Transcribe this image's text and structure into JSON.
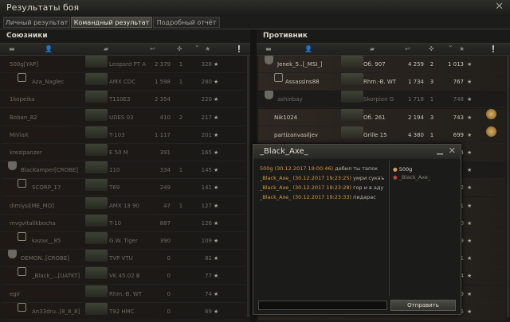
{
  "window": {
    "title": "Результаты боя"
  },
  "tabs": [
    {
      "label": "Личный результат",
      "active": false
    },
    {
      "label": "Командный результат",
      "active": true
    },
    {
      "label": "Подробный отчёт",
      "active": false
    }
  ],
  "allies": {
    "header": "Союзники",
    "rows": [
      {
        "name": "500g[YAP]",
        "tank": "Leopard PT A",
        "damage": "2 379",
        "kills": "1",
        "xp": "328",
        "alive": false,
        "platoon": false,
        "clan": false
      },
      {
        "name": "Aza_Naglec",
        "tank": "AMX CDC",
        "damage": "1 598",
        "kills": "1",
        "xp": "280",
        "alive": false,
        "platoon": true,
        "clan": false
      },
      {
        "name": "1kopeika",
        "tank": "T110E3",
        "damage": "2 354",
        "kills": "",
        "xp": "220",
        "alive": false,
        "platoon": false,
        "clan": false
      },
      {
        "name": "Boban_82",
        "tank": "UDES 03",
        "damage": "410",
        "kills": "2",
        "xp": "217",
        "alive": false,
        "platoon": false,
        "clan": false
      },
      {
        "name": "MiViaX",
        "tank": "T-103",
        "damage": "1 117",
        "kills": "",
        "xp": "201",
        "alive": false,
        "platoon": false,
        "clan": false
      },
      {
        "name": "krezipanzer",
        "tank": "E 50 M",
        "damage": "391",
        "kills": "",
        "xp": "165",
        "alive": false,
        "platoon": false,
        "clan": false
      },
      {
        "name": "BlacKamper[CROBE]",
        "tank": "110",
        "damage": "334",
        "kills": "1",
        "xp": "145",
        "alive": false,
        "platoon": false,
        "clan": true
      },
      {
        "name": "SCORP_17",
        "tank": "T69",
        "damage": "249",
        "kills": "",
        "xp": "141",
        "alive": false,
        "platoon": true,
        "clan": false
      },
      {
        "name": "dimiysi[ME_MO]",
        "tank": "AMX 13 90",
        "damage": "47",
        "kills": "1",
        "xp": "127",
        "alive": false,
        "platoon": false,
        "clan": false
      },
      {
        "name": "mvgvitalikbocha",
        "tank": "T-10",
        "damage": "887",
        "kills": "",
        "xp": "126",
        "alive": false,
        "platoon": false,
        "clan": false
      },
      {
        "name": "kazax__85",
        "tank": "G.W. Tiger",
        "damage": "390",
        "kills": "",
        "xp": "109",
        "alive": false,
        "platoon": true,
        "clan": false
      },
      {
        "name": "DEMON..[CROBE]",
        "tank": "TVP VTU",
        "damage": "0",
        "kills": "",
        "xp": "82",
        "alive": false,
        "platoon": true,
        "clan": true
      },
      {
        "name": "_Black_...[UATKT]",
        "tank": "VK 45.02 B",
        "damage": "0",
        "kills": "",
        "xp": "77",
        "alive": false,
        "platoon": true,
        "clan": false
      },
      {
        "name": "egir",
        "tank": "Rhm.-B. WT",
        "damage": "0",
        "kills": "",
        "xp": "74",
        "alive": false,
        "platoon": false,
        "clan": false
      },
      {
        "name": "An33dru..[8_8_8]",
        "tank": "T92 HMC",
        "damage": "0",
        "kills": "",
        "xp": "69",
        "alive": false,
        "platoon": true,
        "clan": false
      }
    ]
  },
  "enemies": {
    "header": "Противник",
    "rows": [
      {
        "name": "Jenek_5..[_MSI_]",
        "tank": "Об. 907",
        "damage": "4 259",
        "kills": "2",
        "xp": "1 013",
        "alive": true,
        "platoon": false,
        "clan": true,
        "medal": false
      },
      {
        "name": "Assassins88",
        "tank": "Rhm.-B. WT",
        "damage": "1 734",
        "kills": "3",
        "xp": "767",
        "alive": true,
        "platoon": true,
        "clan": false,
        "medal": false
      },
      {
        "name": "ashinbay",
        "tank": "Skorpion G",
        "damage": "1 718",
        "kills": "1",
        "xp": "748",
        "alive": false,
        "platoon": false,
        "clan": true,
        "medal": false
      },
      {
        "name": "Nik1024",
        "tank": "Об. 261",
        "damage": "2 194",
        "kills": "3",
        "xp": "743",
        "alive": true,
        "platoon": false,
        "clan": false,
        "medal": true
      },
      {
        "name": "partizanvasiljev",
        "tank": "Grille 15",
        "damage": "4 380",
        "kills": "1",
        "xp": "699",
        "alive": true,
        "platoon": false,
        "clan": false,
        "medal": true
      },
      {
        "name": "",
        "tank": "",
        "damage": "",
        "kills": "",
        "xp": "94",
        "alive": true,
        "platoon": false,
        "clan": false,
        "medal": false
      },
      {
        "name": "",
        "tank": "",
        "damage": "",
        "kills": "",
        "xp": "",
        "alive": false,
        "platoon": false,
        "clan": false,
        "medal": false
      },
      {
        "name": "",
        "tank": "",
        "damage": "",
        "kills": "",
        "xp": "72",
        "alive": true,
        "platoon": false,
        "clan": false,
        "medal": false
      },
      {
        "name": "",
        "tank": "",
        "damage": "",
        "kills": "",
        "xp": "71",
        "alive": true,
        "platoon": false,
        "clan": false,
        "medal": false
      },
      {
        "name": "",
        "tank": "",
        "damage": "",
        "kills": "",
        "xp": "70",
        "alive": true,
        "platoon": false,
        "clan": false,
        "medal": false
      },
      {
        "name": "",
        "tank": "",
        "damage": "",
        "kills": "",
        "xp": "69",
        "alive": true,
        "platoon": false,
        "clan": false,
        "medal": false
      },
      {
        "name": "",
        "tank": "",
        "damage": "",
        "kills": "",
        "xp": "51",
        "alive": true,
        "platoon": false,
        "clan": false,
        "medal": false
      },
      {
        "name": "",
        "tank": "",
        "damage": "",
        "kills": "",
        "xp": "44",
        "alive": true,
        "platoon": false,
        "clan": false,
        "medal": false
      },
      {
        "name": "",
        "tank": "",
        "damage": "",
        "kills": "",
        "xp": "39",
        "alive": true,
        "platoon": false,
        "clan": false,
        "medal": false
      },
      {
        "name": "",
        "tank": "",
        "damage": "",
        "kills": "",
        "xp": "25",
        "alive": true,
        "platoon": false,
        "clan": false,
        "medal": false
      }
    ]
  },
  "chat": {
    "title": "_Black_Axe_",
    "messages": [
      {
        "sender": "500g",
        "time": "(30.12.2017 19:00:46)",
        "text": "дебил ты тапок"
      },
      {
        "sender": "_Black_Axe_",
        "time": "(30.12.2017 19:23:25)",
        "text": "умри сукаъ"
      },
      {
        "sender": "_Black_Axe_",
        "time": "(30.12.2017 19:23:28)",
        "text": "гор и в аду"
      },
      {
        "sender": "_Black_Axe_",
        "time": "(30.12.2017 19:23:33)",
        "text": "пидарас"
      }
    ],
    "users": [
      {
        "name": "500g",
        "online": true
      },
      {
        "name": "_Black_Axe_",
        "online": false
      }
    ],
    "send_label": "Отправить",
    "input_value": ""
  }
}
